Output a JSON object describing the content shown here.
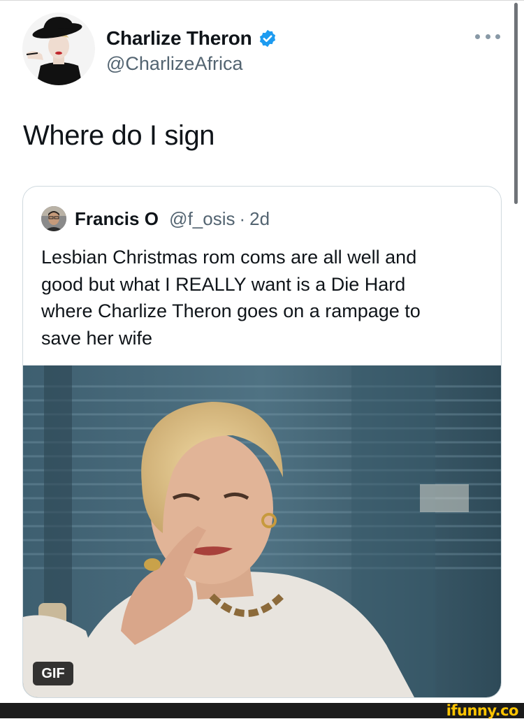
{
  "tweet": {
    "author_name": "Charlize Theron",
    "author_handle": "@CharlizeAfrica",
    "text": "Where do I sign",
    "verified": true
  },
  "quoted_tweet": {
    "author_name": "Francis O",
    "author_handle": "@f_osis",
    "separator": "·",
    "time": "2d",
    "text_lines": [
      "Lesbian Christmas rom coms are all well and",
      "good but what I REALLY want is a Die Hard",
      "where Charlize Theron goes on a rampage to",
      "save her wife"
    ],
    "media_badge": "GIF"
  },
  "watermark": "ifunny.co",
  "icons": [
    "verified-badge-icon",
    "more-options-icon"
  ],
  "colors": {
    "verified_blue": "#1d9bf0",
    "secondary_text": "#536471",
    "watermark_yellow": "#ffc400"
  }
}
